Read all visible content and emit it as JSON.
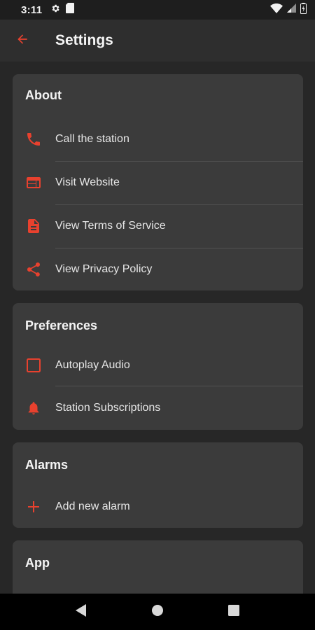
{
  "status_bar": {
    "time": "3:11"
  },
  "app_bar": {
    "title": "Settings"
  },
  "colors": {
    "accent": "#e8412e",
    "background": "#272727",
    "card": "#3b3b3b",
    "app_bar": "#2e2e2e"
  },
  "sections": {
    "about": {
      "title": "About",
      "items": [
        {
          "label": "Call the station",
          "icon": "phone-icon"
        },
        {
          "label": "Visit Website",
          "icon": "web-icon"
        },
        {
          "label": "View Terms of Service",
          "icon": "document-icon"
        },
        {
          "label": "View Privacy Policy",
          "icon": "share-icon"
        }
      ]
    },
    "preferences": {
      "title": "Preferences",
      "items": [
        {
          "label": "Autoplay Audio",
          "icon": "checkbox-icon",
          "checked": false
        },
        {
          "label": "Station Subscriptions",
          "icon": "bell-icon"
        }
      ]
    },
    "alarms": {
      "title": "Alarms",
      "items": [
        {
          "label": "Add new alarm",
          "icon": "plus-icon"
        }
      ]
    },
    "app": {
      "title": "App"
    }
  }
}
